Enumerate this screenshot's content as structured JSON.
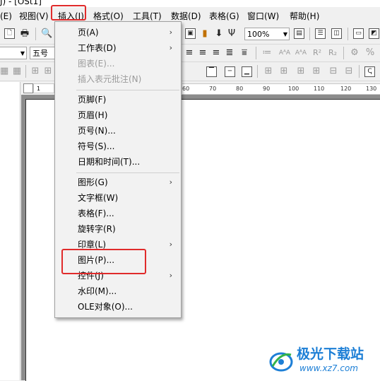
{
  "window": {
    "title": "J) - [OSt1]"
  },
  "menubar": {
    "items": [
      "(E)",
      "视图(V)",
      "插入(I)",
      "格式(O)",
      "工具(T)",
      "数据(D)",
      "表格(G)",
      "窗口(W)",
      "帮助(H)"
    ]
  },
  "toolbar": {
    "zoom_value": "100%",
    "font_size_value": "五号",
    "symbols": {
      "binoculars": "🔍",
      "omega": "Ψ",
      "arrow_down": "⬇",
      "superscript": "R²",
      "subscript": "R₂",
      "percent": "%"
    }
  },
  "ruler": {
    "left_label": "1",
    "ticks": [
      "60",
      "70",
      "80",
      "90",
      "100",
      "110",
      "120",
      "130"
    ]
  },
  "insert_menu": {
    "items": [
      {
        "label": "页(A)",
        "enabled": true,
        "submenu": true
      },
      {
        "label": "工作表(D)",
        "enabled": true,
        "submenu": true
      },
      {
        "label": "图表(E)...",
        "enabled": false,
        "submenu": false
      },
      {
        "label": "插入表元批注(N)",
        "enabled": false,
        "submenu": false
      },
      {
        "label": "页脚(F)",
        "enabled": true,
        "submenu": false
      },
      {
        "label": "页眉(H)",
        "enabled": true,
        "submenu": false
      },
      {
        "label": "页号(N)...",
        "enabled": true,
        "submenu": false
      },
      {
        "label": "符号(S)...",
        "enabled": true,
        "submenu": false
      },
      {
        "label": "日期和时间(T)...",
        "enabled": true,
        "submenu": false
      },
      {
        "label": "图形(G)",
        "enabled": true,
        "submenu": true
      },
      {
        "label": "文字框(W)",
        "enabled": true,
        "submenu": false
      },
      {
        "label": "表格(F)...",
        "enabled": true,
        "submenu": false
      },
      {
        "label": "旋转字(R)",
        "enabled": true,
        "submenu": false
      },
      {
        "label": "印章(L)",
        "enabled": true,
        "submenu": true
      },
      {
        "label": "图片(P)...",
        "enabled": true,
        "submenu": false
      },
      {
        "label": "控件(J)",
        "enabled": true,
        "submenu": true
      },
      {
        "label": "水印(M)...",
        "enabled": true,
        "submenu": false
      },
      {
        "label": "OLE对象(O)...",
        "enabled": true,
        "submenu": false
      }
    ]
  },
  "watermark": {
    "brand": "极光下载站",
    "url": "www.xz7.com"
  },
  "colors": {
    "highlight": "#e02b2b",
    "brand": "#1d7fd6"
  }
}
